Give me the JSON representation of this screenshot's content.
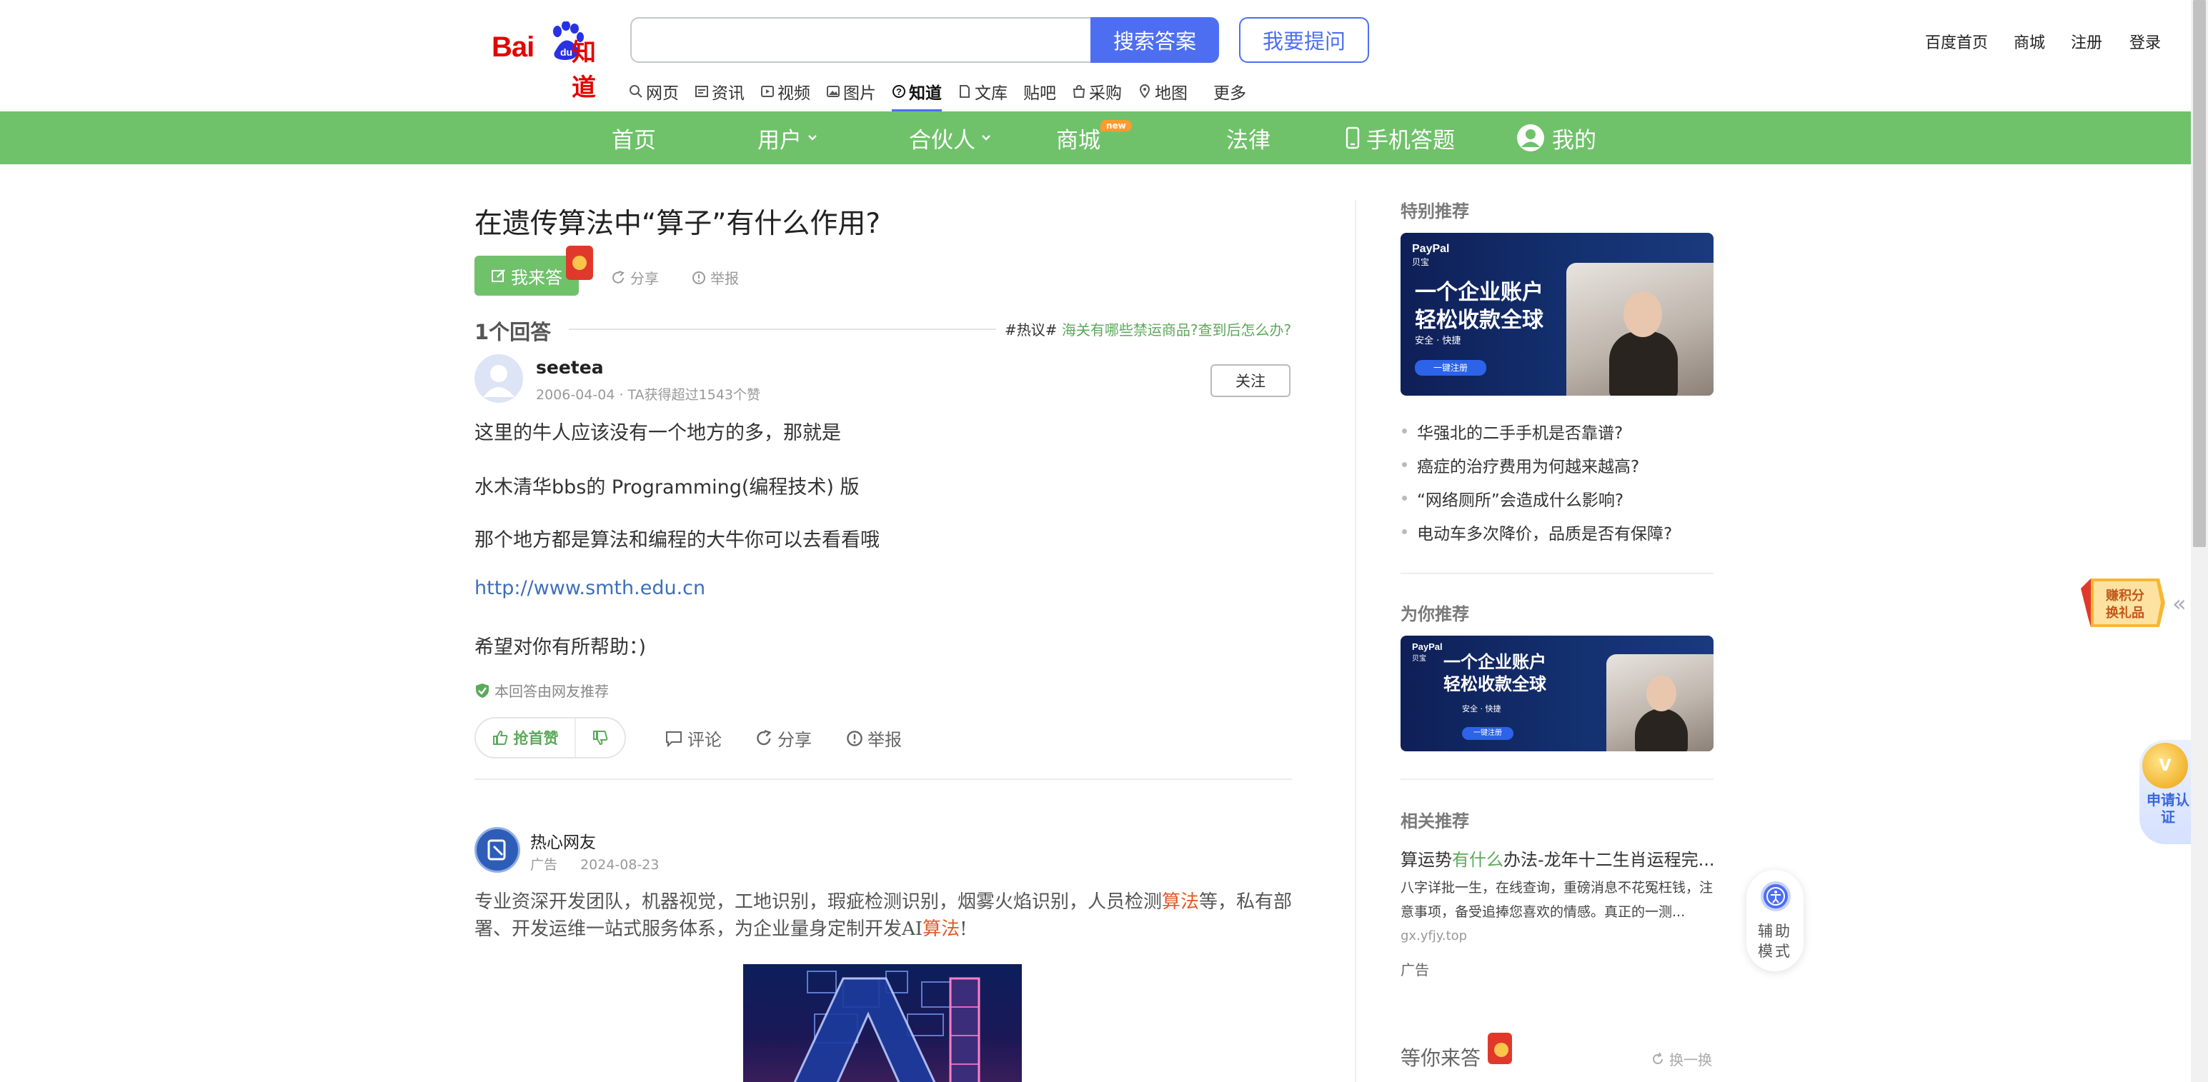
{
  "header": {
    "logo": "Baidu知道",
    "search": {
      "value": "",
      "button": "搜索答案"
    },
    "ask_button": "我要提问",
    "top_links": [
      "百度首页",
      "商城",
      "注册",
      "登录"
    ],
    "subnav": [
      "网页",
      "资讯",
      "视频",
      "图片",
      "知道",
      "文库",
      "贴吧",
      "采购",
      "地图",
      "更多"
    ],
    "subnav_active": "知道"
  },
  "green_nav": {
    "items": [
      "首页",
      "用户",
      "合伙人",
      "商城",
      "法律",
      "手机答题",
      "我的"
    ],
    "new_badge": "new",
    "color": "#6fc26a"
  },
  "question": {
    "title": "在遗传算法中“算子”有什么作用?",
    "answer_button": "我来答",
    "share": "分享",
    "report": "举报"
  },
  "answers": {
    "count_label": "1个回答",
    "hot_prefix": "#热议#",
    "hot_link": "海关有哪些禁运商品?查到后怎么办?",
    "answer": {
      "username": "seetea",
      "meta": "2006-04-04 · TA获得超过1543个赞",
      "follow": "关注",
      "paragraphs": [
        "这里的牛人应该没有一个地方的多，那就是",
        "水木清华bbs的 Programming(编程技术) 版",
        "那个地方都是算法和编程的大牛你可以去看看哦",
        "http://www.smth.edu.cn",
        "希望对你有所帮助：)"
      ],
      "recommend_note": "本回答由网友推荐",
      "vote_up": "抢首赞",
      "comment": "评论",
      "share": "分享",
      "report": "举报"
    }
  },
  "ad_post": {
    "name": "热心网友",
    "tag": "广告",
    "date": "2024-08-23",
    "text_1": "专业资深开发团队，机器视觉，工地识别，瑕疵检测识别，烟雾火焰识别，人员检测",
    "hl_1": "算法",
    "text_2": "等，私有部署、开发运维一站式服务体系，为企业量身定制开发AI",
    "hl_2": "算法",
    "text_3": "!"
  },
  "sidebar": {
    "special_title": "特别推荐",
    "ad_brand": "PayPal",
    "ad_brand_cn": "贝宝",
    "ad_line1": "一个企业账户",
    "ad_line2": "轻松收款全球",
    "ad_safety": "安全 · 快捷",
    "ad_cta": "一键注册",
    "hot_list": [
      "华强北的二手手机是否靠谱?",
      "癌症的治疗费用为何越来越高?",
      "“网络厕所”会造成什么影响?",
      "电动车多次降价，品质是否有保障?"
    ],
    "for_you_title": "为你推荐",
    "related_title": "相关推荐",
    "related_item": {
      "title_pre": "算运势",
      "title_hl": "有什么",
      "title_post": "办法-龙年十二生肖运程完...",
      "desc": "八字详批一生，在线查询，重磅消息不花冤枉钱，注意事项，备受追捧您喜欢的情感。真正的一测...",
      "domain": "gx.yfjy.top",
      "ad_tag": "广告"
    },
    "wait_title": "等你来答",
    "refresh": "换一换"
  },
  "floating": {
    "points_line1": "赚积分",
    "points_line2": "换礼品",
    "cert_coin": "V",
    "cert_text": "申请认证",
    "assist_text": "辅助模式"
  }
}
